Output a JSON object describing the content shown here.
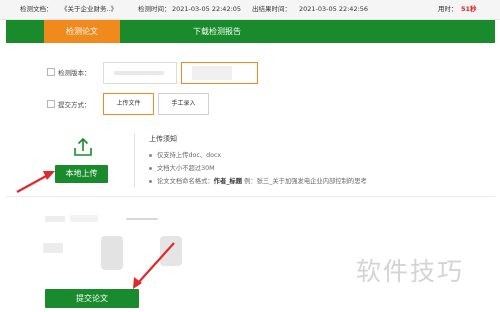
{
  "topbar": {
    "doc_label": "检测文档：",
    "doc_name": "《关于企业财务..》",
    "check_time_label": "检测时间：",
    "check_time": "2021-03-05 22:42:05",
    "result_time_label": "出结果时间：",
    "result_time": "2021-03-05 22:42:56",
    "elapsed_label": "用时：",
    "elapsed": "51秒"
  },
  "nav": {
    "tabs": [
      {
        "label": "检测论文",
        "active": true
      },
      {
        "label": "下载检测报告",
        "active": false
      }
    ]
  },
  "form": {
    "version_label": "检测版本：",
    "method_label": "提交方式：",
    "upload_file_label": "上传文件",
    "manual_input_label": "手工录入"
  },
  "upload": {
    "local_upload_label": "本地上传",
    "icon": "upload-icon"
  },
  "notes": {
    "title": "上传须知",
    "items": [
      {
        "text": "仅支持上传doc、docx"
      },
      {
        "text": "文档大小不超过30M"
      },
      {
        "prefix": "论文文档命名格式：",
        "bold": "作者_标题",
        "suffix": " 例：张三_关于加强发电企业内部控制的思考"
      }
    ]
  },
  "submit": {
    "label": "提交论文"
  },
  "watermark": {
    "text": "软件技巧"
  },
  "colors": {
    "green": "#1a8b2c",
    "orange": "#f08a1c",
    "red_text": "#e02020",
    "arrow": "#e0292b"
  }
}
